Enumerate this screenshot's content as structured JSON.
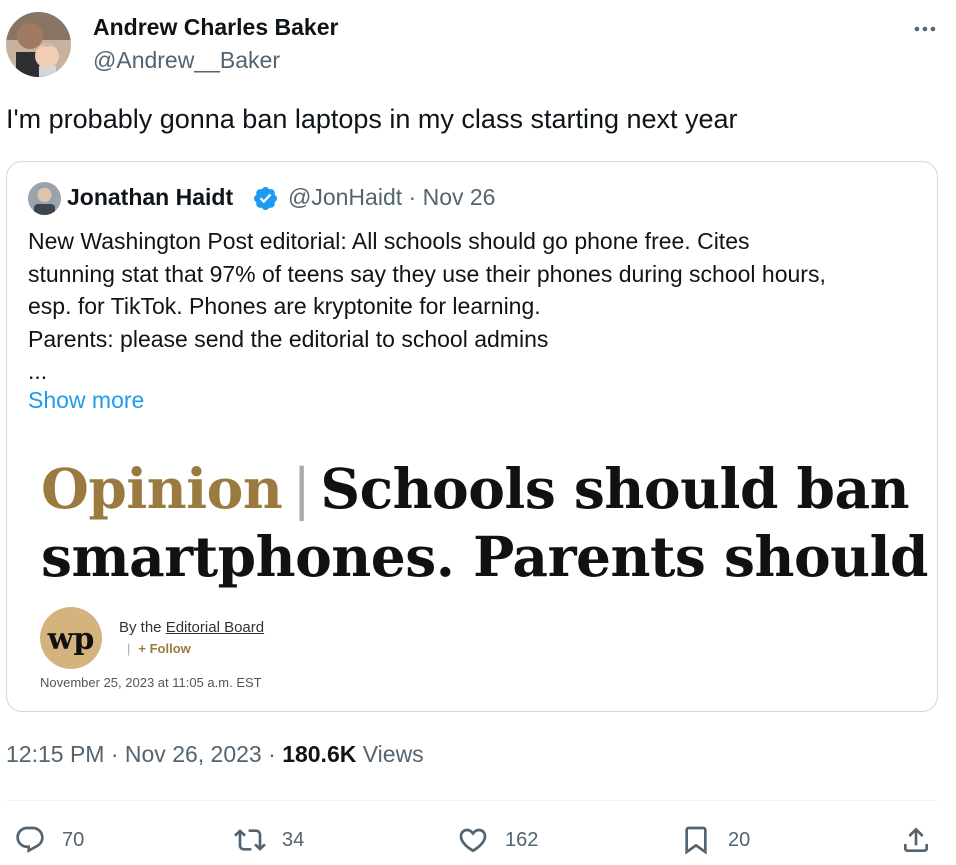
{
  "tweet": {
    "author": {
      "name": "Andrew Charles Baker",
      "handle": "@Andrew__Baker"
    },
    "text": "I'm probably gonna ban laptops in my class starting next year",
    "time": "12:15 PM",
    "separator": "·",
    "date": "Nov 26, 2023",
    "views_count": "180.6K",
    "views_label": "Views"
  },
  "quote": {
    "author_name": "Jonathan Haidt",
    "handle": "@JonHaidt",
    "date": "Nov 26",
    "text_lines": [
      "New Washington Post editorial: All schools should go phone free. Cites",
      "stunning stat that 97% of teens say they use their phones during school hours,",
      "esp. for TikTok. Phones are kryptonite for learning.",
      "Parents: please send the editorial to school admins",
      "..."
    ],
    "show_more": "Show more",
    "article": {
      "label": "Opinion",
      "separator": "|",
      "headline_line1": "Schools should ban",
      "headline_line2": "smartphones. Parents should help.",
      "byline_prefix": "By the",
      "byline_author": "Editorial Board",
      "follow_separator": "|",
      "follow_label": "+ Follow",
      "date": "November 25, 2023 at 11:05 a.m. EST"
    }
  },
  "actions": {
    "reply": {
      "icon": "reply-icon",
      "count": "70"
    },
    "retweet": {
      "icon": "retweet-icon",
      "count": "34"
    },
    "like": {
      "icon": "heart-icon",
      "count": "162"
    },
    "bookmark": {
      "icon": "bookmark-icon",
      "count": "20"
    },
    "share": {
      "icon": "share-icon"
    }
  },
  "colors": {
    "text": "#0f1419",
    "secondary": "#536471",
    "link": "#1d9bf0",
    "verified": "#1d9bf0",
    "border": "#cfd9de",
    "opinion_gold": "#9a7a3f",
    "wp_logo_bg": "#d4b37e"
  }
}
